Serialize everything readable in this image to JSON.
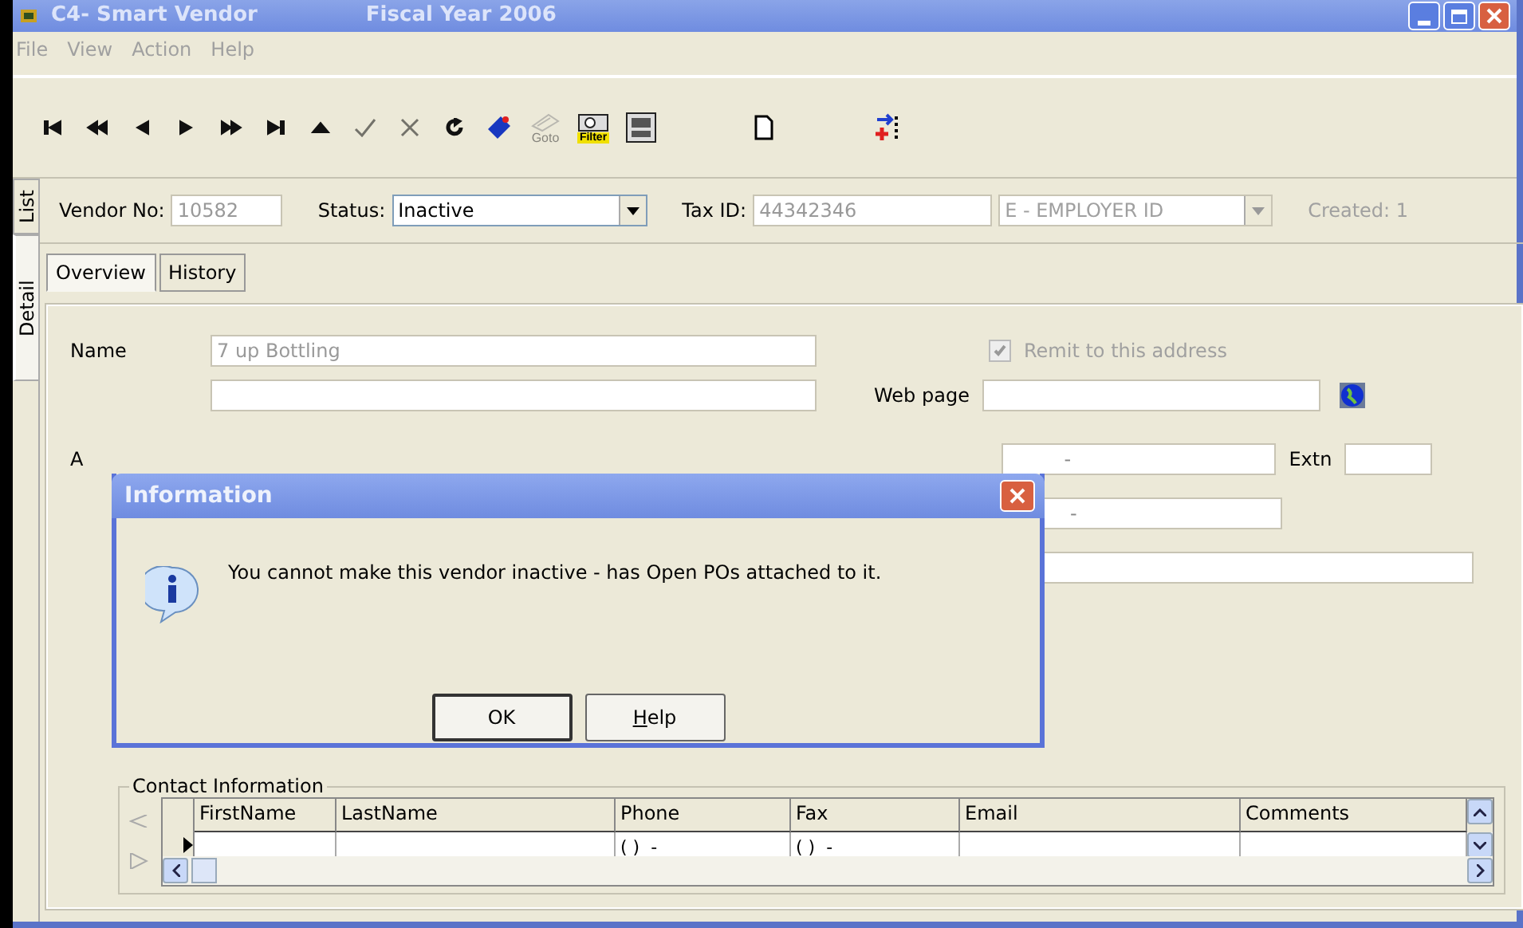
{
  "window": {
    "title": "C4- Smart Vendor",
    "subtitle": "Fiscal Year 2006"
  },
  "menu": [
    "File",
    "View",
    "Action",
    "Help"
  ],
  "toolbar": [
    {
      "kind": "first",
      "disabled": false
    },
    {
      "kind": "prev-page",
      "disabled": false
    },
    {
      "kind": "prev",
      "disabled": false
    },
    {
      "kind": "next",
      "disabled": false
    },
    {
      "kind": "next-page",
      "disabled": false
    },
    {
      "kind": "last",
      "disabled": false
    },
    {
      "kind": "up",
      "disabled": false
    },
    {
      "kind": "check",
      "disabled": true
    },
    {
      "kind": "cancel",
      "disabled": true
    },
    {
      "kind": "refresh",
      "disabled": false
    },
    {
      "kind": "tag",
      "disabled": false
    },
    {
      "kind": "goto",
      "label": "Goto",
      "disabled": true
    },
    {
      "kind": "filter",
      "label": "Filter",
      "disabled": false
    },
    {
      "kind": "picture",
      "disabled": false
    },
    {
      "kind": "new",
      "disabled": false
    },
    {
      "kind": "insert",
      "disabled": false
    }
  ],
  "side_tabs": [
    {
      "label": "List",
      "selected": false
    },
    {
      "label": "Detail",
      "selected": true
    }
  ],
  "header": {
    "vendor_no_label": "Vendor No:",
    "vendor_no": "10582",
    "status_label": "Status:",
    "status": "Inactive",
    "tax_id_label": "Tax ID:",
    "tax_id": "44342346",
    "tax_type": "E - EMPLOYER ID",
    "created_label": "Created: 1"
  },
  "tabs": [
    {
      "label": "Overview",
      "selected": true
    },
    {
      "label": "History",
      "selected": false
    }
  ],
  "form": {
    "name_label": "Name",
    "name": "7 up Bottling",
    "remit_label": "Remit to this address",
    "remit_checked": true,
    "web_label": "Web page",
    "address_label": "A",
    "phone": "-",
    "fax": "-",
    "extn_label": "Extn"
  },
  "contacts": {
    "title": "Contact Information",
    "columns": [
      "FirstName",
      "LastName",
      "Phone",
      "Fax",
      "Email",
      "Comments"
    ],
    "rows": [
      {
        "cells": [
          "",
          "",
          "( )  -",
          "( )  -",
          "",
          ""
        ],
        "selected": true
      }
    ]
  },
  "dialog": {
    "title": "Information",
    "message": "You cannot make this vendor inactive - has Open POs attached to it.",
    "buttons": [
      {
        "label": "OK",
        "default": true,
        "mnemonic": false
      },
      {
        "label": "Help",
        "default": false,
        "mnemonic": true
      }
    ]
  }
}
